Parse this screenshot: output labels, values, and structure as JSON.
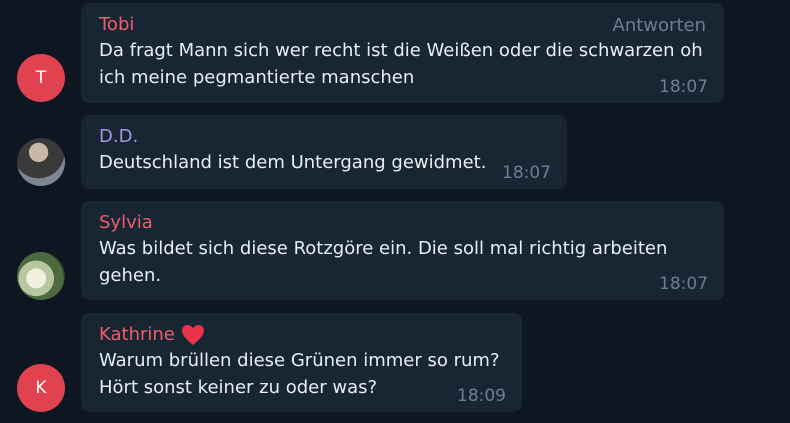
{
  "colors": {
    "background": "#0e1621",
    "bubble": "#182533",
    "message_text": "#e9eef3",
    "meta_text": "#6d7f8f",
    "name_red": "#f05d6c",
    "name_purple": "#a695e7",
    "avatar_red": "#e0424f",
    "heart": "#e8334a"
  },
  "messages": [
    {
      "sender": "Tobi",
      "avatar_letter": "T",
      "text": "Da fragt Mann sich wer recht ist die Weißen oder die schwarzen oh\nich meine pegmantierte manschen",
      "time": "18:07",
      "reply_label": "Antworten"
    },
    {
      "sender": "D.D.",
      "avatar_icon": "user-photo",
      "text": "Deutschland ist dem Untergang gewidmet.",
      "time": "18:07"
    },
    {
      "sender": "Sylvia",
      "avatar_icon": "user-photo",
      "text": "Was bildet sich diese Rotzgöre ein. Die soll mal richtig arbeiten\ngehen.",
      "time": "18:07"
    },
    {
      "sender": "Kathrine",
      "sender_icon": "heart-icon",
      "avatar_letter": "K",
      "text": "Warum brüllen diese Grünen immer so rum?\nHört sonst keiner zu oder was?",
      "time": "18:09"
    }
  ]
}
